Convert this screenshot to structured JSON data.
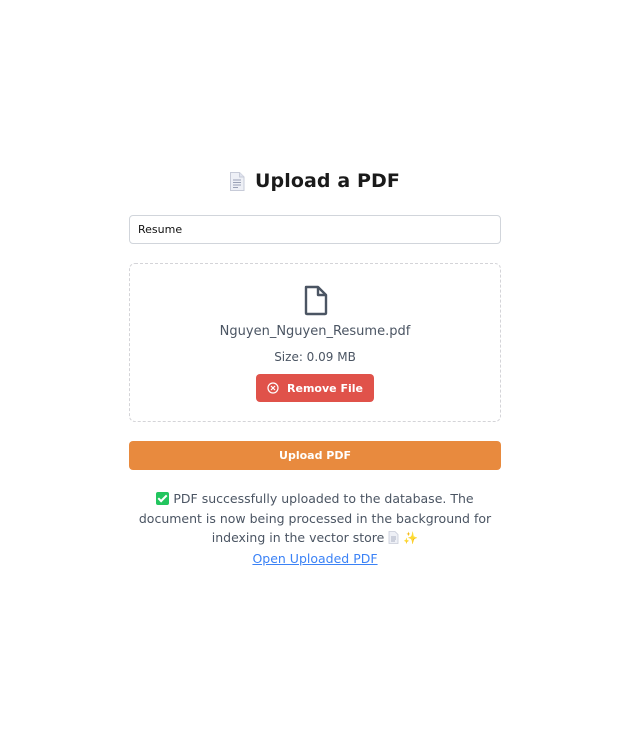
{
  "header": {
    "title": "Upload a PDF",
    "icon": "page-document-icon"
  },
  "name_field": {
    "value": "Resume"
  },
  "dropzone": {
    "file_name": "Nguyen_Nguyen_Resume.pdf",
    "file_size": "Size: 0.09 MB",
    "remove_label": "Remove File",
    "remove_icon": "circle-x-icon"
  },
  "upload": {
    "label": "Upload PDF"
  },
  "status": {
    "icon": "checkmark-box-icon",
    "message": "PDF successfully uploaded to the database. The document is now being processed in the background for indexing in the vector store",
    "link_label": "Open Uploaded PDF"
  },
  "colors": {
    "remove_button": "#e0524a",
    "upload_button": "#e88a3e",
    "success_check": "#22c55e",
    "link": "#3b82f6"
  }
}
